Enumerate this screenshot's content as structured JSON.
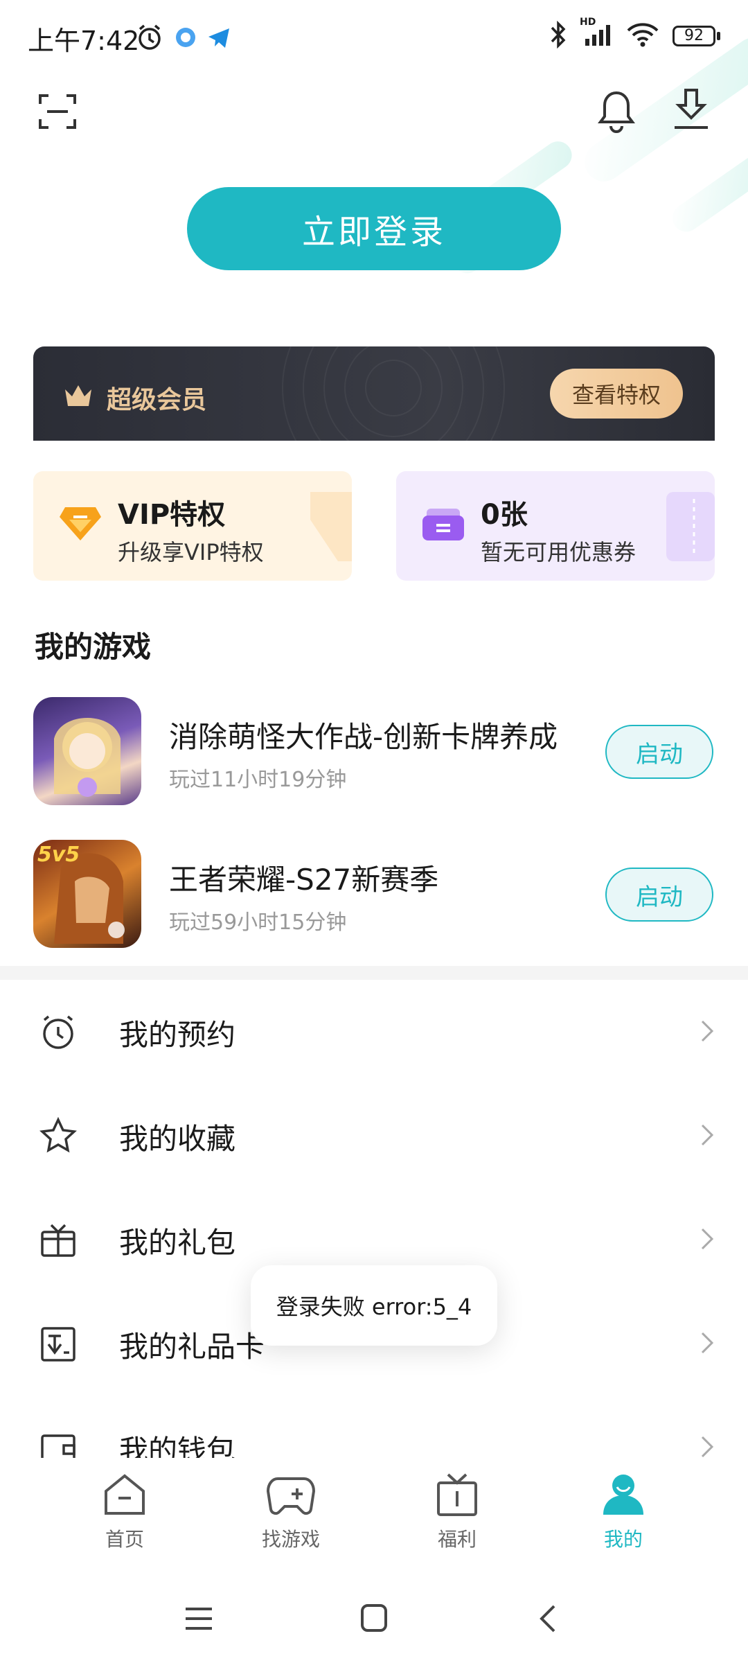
{
  "status_bar": {
    "time": "上午7:42",
    "battery": "92",
    "network_label": "HD"
  },
  "header": {
    "login_button": "立即登录"
  },
  "vip_banner": {
    "title": "超级会员",
    "button": "查看特权",
    "accent": "#e9c79b"
  },
  "tiles": [
    {
      "title": "VIP特权",
      "subtitle": "升级享VIP特权"
    },
    {
      "title": "0张",
      "subtitle": "暂无可用优惠券"
    }
  ],
  "my_games": {
    "title": "我的游戏",
    "items": [
      {
        "name": "消除萌怪大作战-创新卡牌养成",
        "played": "玩过11小时19分钟",
        "action": "启动"
      },
      {
        "name": "王者荣耀-S27新赛季",
        "played": "玩过59小时15分钟",
        "action": "启动",
        "badge": "5v5"
      }
    ]
  },
  "menu": [
    {
      "label": "我的预约",
      "icon": "alarm-clock-icon"
    },
    {
      "label": "我的收藏",
      "icon": "star-icon"
    },
    {
      "label": "我的礼包",
      "icon": "gift-box-icon"
    },
    {
      "label": "我的礼品卡",
      "icon": "gift-card-icon"
    },
    {
      "label": "我的钱包",
      "icon": "wallet-icon"
    }
  ],
  "toast": "登录失败  error:5_4",
  "tabs": [
    {
      "label": "首页",
      "icon": "home-icon",
      "active": false
    },
    {
      "label": "找游戏",
      "icon": "gamepad-icon",
      "active": false
    },
    {
      "label": "福利",
      "icon": "gift-icon",
      "active": false
    },
    {
      "label": "我的",
      "icon": "profile-icon",
      "active": true
    }
  ],
  "colors": {
    "primary": "#1fb8c3",
    "vip_dark": "#2b2d36",
    "vip_gold": "#efc38f"
  }
}
